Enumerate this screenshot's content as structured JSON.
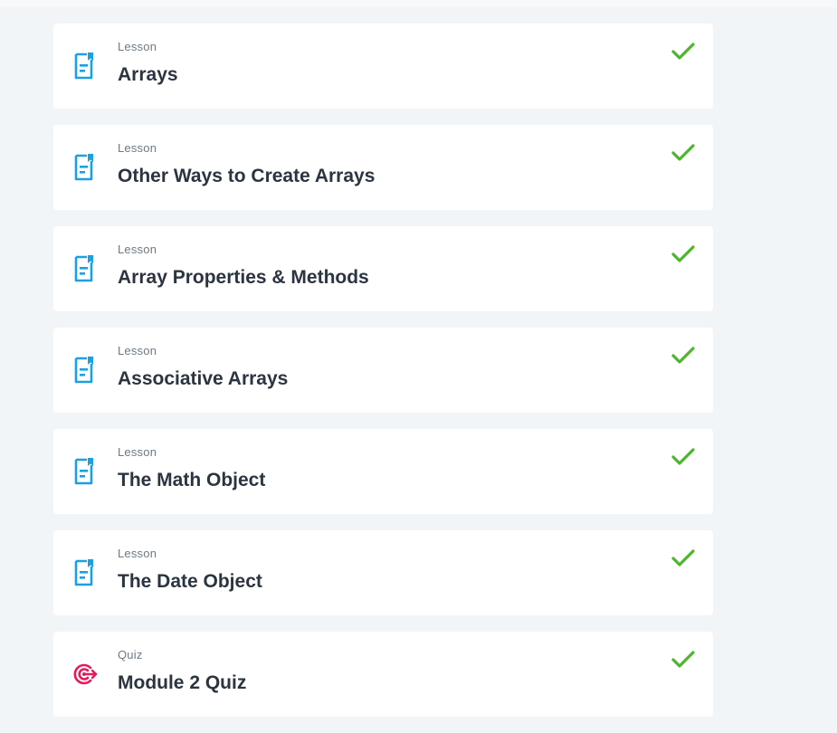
{
  "colors": {
    "lesson_icon": "#1aa0e6",
    "quiz_icon": "#e5195c",
    "check": "#4db62b",
    "title": "#2b3440",
    "type": "#6b7a86",
    "background": "#f1f5f8"
  },
  "items": [
    {
      "type": "Lesson",
      "title": "Arrays",
      "icon": "lesson-document-icon",
      "completed": true
    },
    {
      "type": "Lesson",
      "title": "Other Ways to Create Arrays",
      "icon": "lesson-document-icon",
      "completed": true
    },
    {
      "type": "Lesson",
      "title": "Array Properties & Methods",
      "icon": "lesson-document-icon",
      "completed": true
    },
    {
      "type": "Lesson",
      "title": "Associative Arrays",
      "icon": "lesson-document-icon",
      "completed": true
    },
    {
      "type": "Lesson",
      "title": "The Math Object",
      "icon": "lesson-document-icon",
      "completed": true
    },
    {
      "type": "Lesson",
      "title": "The Date Object",
      "icon": "lesson-document-icon",
      "completed": true
    },
    {
      "type": "Quiz",
      "title": "Module 2 Quiz",
      "icon": "quiz-target-icon",
      "completed": true
    }
  ]
}
